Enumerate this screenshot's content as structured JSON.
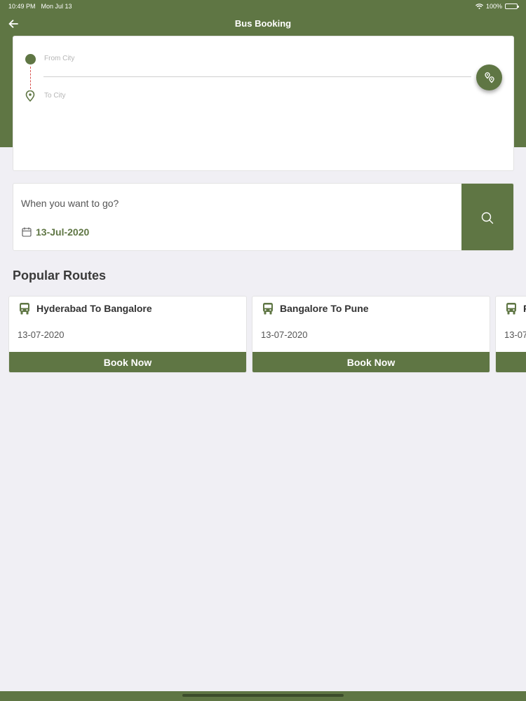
{
  "status_bar": {
    "time": "10:49 PM",
    "date": "Mon Jul 13",
    "battery": "100%"
  },
  "header": {
    "title": "Bus Booking"
  },
  "city_form": {
    "from_placeholder": "From City",
    "to_placeholder": "To City"
  },
  "date_form": {
    "question": "When you want to go?",
    "date": "13-Jul-2020"
  },
  "popular": {
    "title": "Popular Routes",
    "routes": [
      {
        "title": "Hyderabad To Bangalore",
        "date": "13-07-2020",
        "button": "Book Now"
      },
      {
        "title": "Bangalore To Pune",
        "date": "13-07-2020",
        "button": "Book Now"
      },
      {
        "title": "P",
        "date": "13-07",
        "button": ""
      }
    ]
  },
  "colors": {
    "primary": "#5f7644",
    "background": "#f0eff4",
    "route_line": "#d9534f"
  }
}
